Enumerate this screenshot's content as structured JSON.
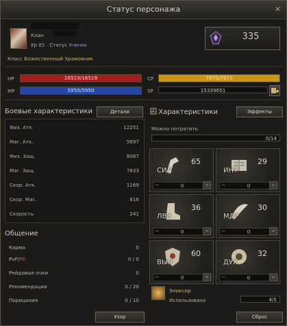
{
  "window": {
    "title": "Статус персонажа"
  },
  "character": {
    "clan_label": "Клан",
    "level_label": "Ур",
    "level": "85",
    "status_label": "Статус",
    "status_value": "Ученик",
    "class_label": "Класс",
    "class_value": "Божественный Храмовник",
    "score": "335"
  },
  "bars": {
    "hp": {
      "label": "HP",
      "text": "16519/16519",
      "fill": 1.0,
      "color": "#a11e1e"
    },
    "mp": {
      "label": "MP",
      "text": "5950/5950",
      "fill": 1.0,
      "color": "#2346a8"
    },
    "cp": {
      "label": "CP",
      "text": "7973/7973",
      "fill": 1.0,
      "color": "#c8951a"
    },
    "sp": {
      "label": "SP",
      "text": "15339651"
    }
  },
  "combat": {
    "title": "Боевые характеристики",
    "details_button": "Детали",
    "rows": [
      {
        "label": "Физ. Атк.",
        "value": "12251"
      },
      {
        "label": "Маг. Атк.",
        "value": "5697"
      },
      {
        "label": "Физ. Защ.",
        "value": "8087"
      },
      {
        "label": "Маг. Защ.",
        "value": "7833"
      },
      {
        "label": "Скор. Атк.",
        "value": "1169"
      },
      {
        "label": "Скор. Маг.",
        "value": "816"
      },
      {
        "label": "Скорость",
        "value": "241"
      }
    ]
  },
  "social": {
    "title": "Общение",
    "karma_label": "Карма",
    "karma_value": "0",
    "pvp_label": "PvP",
    "pk_label": "PK",
    "pvp_value": "0 / 0",
    "raid_label": "Рейдовые очки",
    "raid_value": "0",
    "rec_label": "Рекомендации",
    "rec_value": "0 / 20",
    "cens_label": "Порицания",
    "cens_value": "0 / 10",
    "pattern_button": "Узор"
  },
  "stats": {
    "title": "Характеристики",
    "effects_button": "Эффекты",
    "spend_label": "Можно потратить",
    "spend_value": "0/14",
    "tiles": [
      {
        "name": "СИЛ",
        "value": "65",
        "sub": "0"
      },
      {
        "name": "ИНТ",
        "value": "29",
        "sub": "0"
      },
      {
        "name": "ЛВК",
        "value": "36",
        "sub": "0"
      },
      {
        "name": "МДР",
        "value": "30",
        "sub": "0"
      },
      {
        "name": "ВЫН",
        "value": "60",
        "sub": "0"
      },
      {
        "name": "ДУХ",
        "value": "32",
        "sub": "0"
      }
    ],
    "elixir_label": "Эликсир",
    "elixir_used_label": "Использовано",
    "elixir_value": "4/5",
    "reset_button": "Сброс"
  }
}
